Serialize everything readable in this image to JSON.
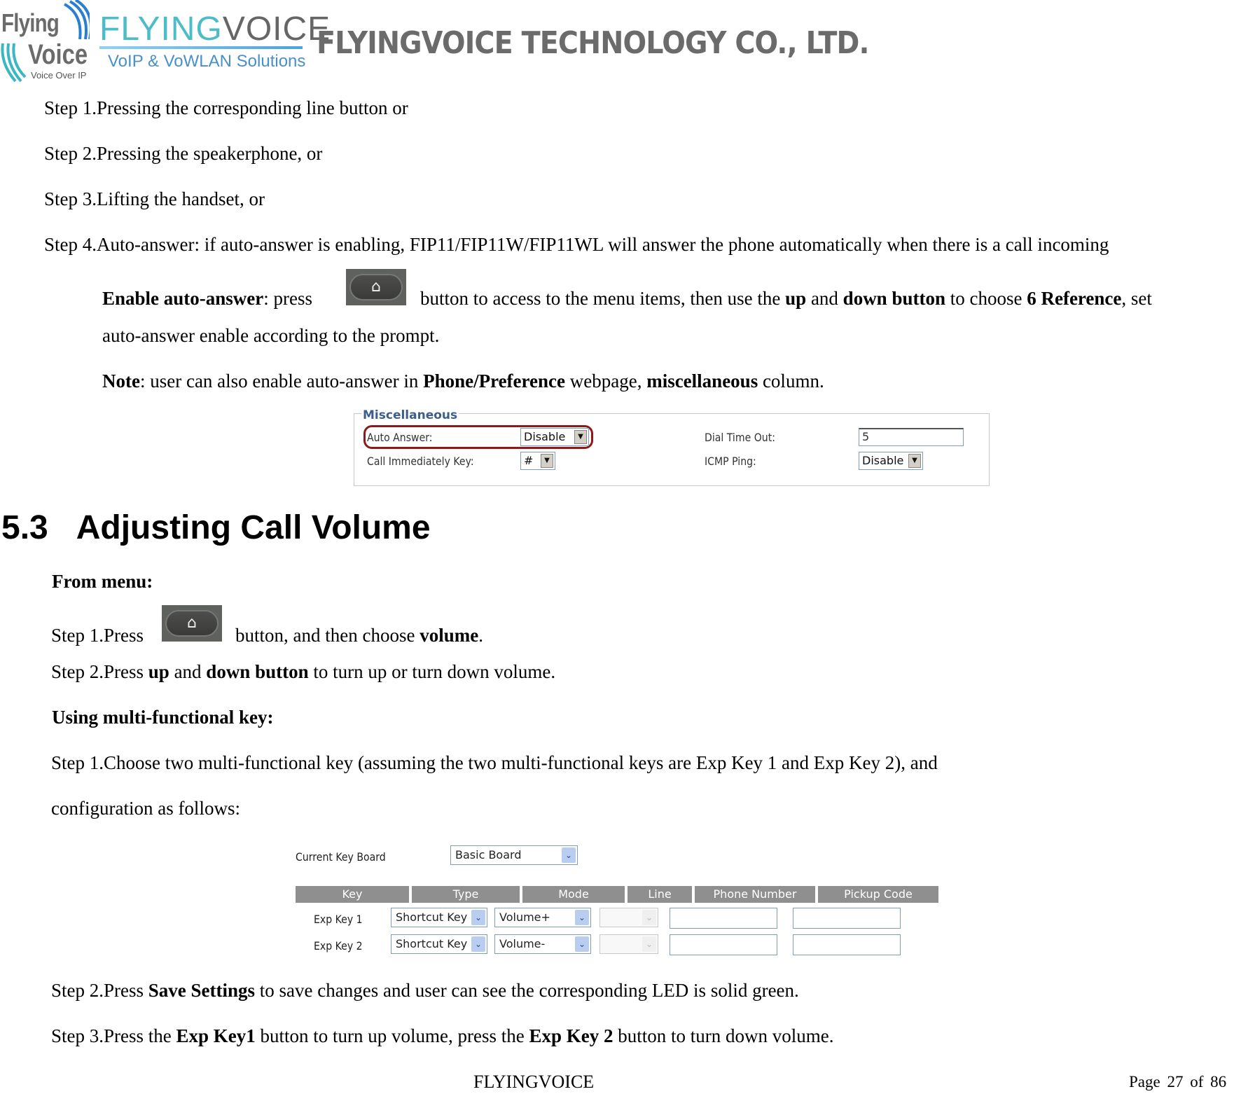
{
  "header": {
    "logo_left": {
      "line1": "Flying",
      "line2": "Voice",
      "tagline": "Voice Over IP"
    },
    "logo_right": {
      "brand_colored": "FLYING",
      "brand_gray": "VOICE",
      "tagline": "VoIP & VoWLAN Solutions"
    },
    "company_name": "FLYINGVOICE TECHNOLOGY CO., LTD."
  },
  "answer_steps": [
    "Step 1.Pressing the corresponding line button or",
    "Step 2.Pressing the speakerphone, or",
    "Step 3.Lifting the handset, or",
    "Step 4.Auto-answer: if auto-answer is enabling, FIP11/FIP11W/FIP11WL will answer the phone automatically when there is a call incoming"
  ],
  "enable_auto_answer": {
    "label": "Enable auto-answer",
    "t1": ": press",
    "t2": "button to access to the menu items, then use the",
    "up": "up",
    "and": "and",
    "down": "down button",
    "t3": "to choose",
    "ref": "6 Reference",
    "t4": ", set",
    "line2": "auto-answer enable according to the prompt."
  },
  "note": {
    "label": "Note",
    "t1": ": user can also enable auto-answer in",
    "page": "Phone/Preference",
    "t2": "webpage,",
    "col": "miscellaneous",
    "t3": "column."
  },
  "misc_panel": {
    "legend": "Miscellaneous",
    "auto_answer": {
      "label": "Auto Answer:",
      "value": "Disable"
    },
    "call_immediately_key": {
      "label": "Call Immediately Key:",
      "value": "#"
    },
    "dial_time_out": {
      "label": "Dial Time Out:",
      "value": "5"
    },
    "icmp_ping": {
      "label": "ICMP Ping:",
      "value": "Disable"
    }
  },
  "section": {
    "number": "5.3",
    "title": "Adjusting Call Volume"
  },
  "from_menu": {
    "heading": "From menu:",
    "step1_a": "Step 1.Press",
    "step1_b": "button, and then choose",
    "step1_c": "volume",
    "step1_d": ".",
    "step2_a": "Step 2.Press",
    "step2_up": "up",
    "step2_and": "and",
    "step2_down": "down button",
    "step2_b": "to turn up or turn down volume."
  },
  "multi_key": {
    "heading": "Using multi-functional key:",
    "step1_line1": "Step 1.Choose two multi-functional key (assuming the two multi-functional keys are Exp Key 1 and Exp Key 2), and",
    "step1_line2": "configuration as follows:"
  },
  "keyboard_config": {
    "current_label": "Current Key Board",
    "current_value": "Basic Board",
    "columns": [
      "Key",
      "Type",
      "Mode",
      "Line",
      "Phone Number",
      "Pickup Code"
    ],
    "rows": [
      {
        "key": "Exp Key 1",
        "type": "Shortcut Key",
        "mode": "Volume+",
        "line": "",
        "phone_number": "",
        "pickup_code": ""
      },
      {
        "key": "Exp Key 2",
        "type": "Shortcut Key",
        "mode": "Volume-",
        "line": "",
        "phone_number": "",
        "pickup_code": ""
      }
    ]
  },
  "after_steps": {
    "s2_a": "Step 2.Press",
    "s2_b": "Save Settings",
    "s2_c": "to save changes and user can see the corresponding LED is solid green.",
    "s3_a": "Step 3.Press the",
    "s3_b": "Exp Key1",
    "s3_c": "button to turn up volume, press the",
    "s3_d": "Exp Key 2",
    "s3_e": "button to turn down volume."
  },
  "footer": {
    "brand": "FLYINGVOICE",
    "page_label": "Page",
    "page": "27",
    "of": "of",
    "total": "86"
  },
  "icons": {
    "home_button": "home-icon"
  }
}
